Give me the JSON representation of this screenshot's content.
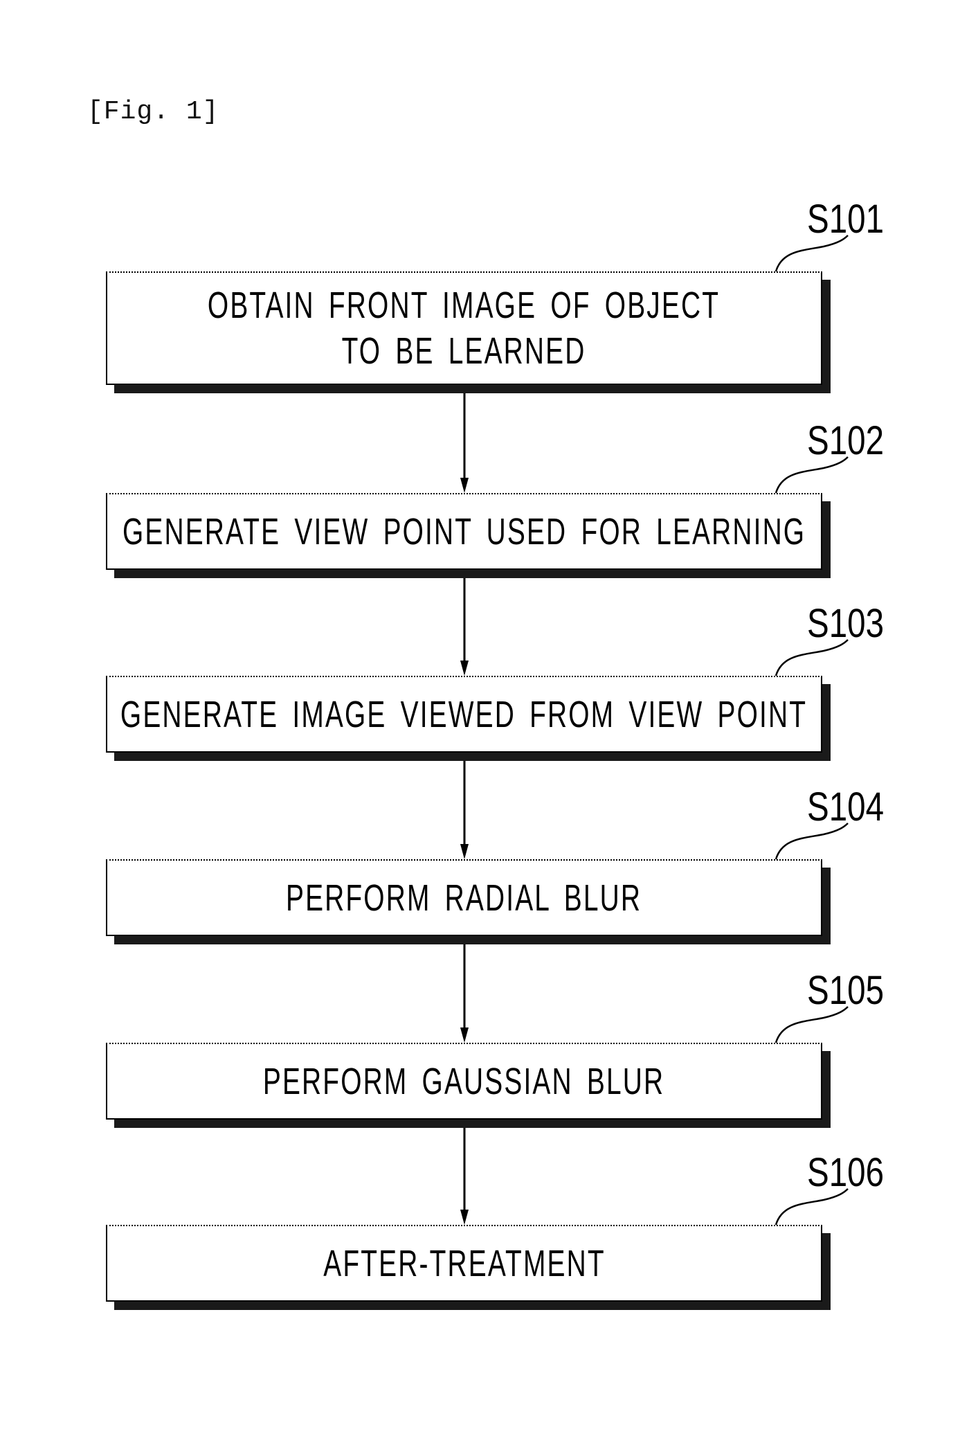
{
  "figure": {
    "label": "[Fig. 1]"
  },
  "steps": [
    {
      "id": "S101",
      "lines": [
        "OBTAIN FRONT IMAGE OF OBJECT",
        "TO BE LEARNED"
      ]
    },
    {
      "id": "S102",
      "lines": [
        "GENERATE VIEW POINT USED FOR LEARNING"
      ]
    },
    {
      "id": "S103",
      "lines": [
        "GENERATE IMAGE VIEWED FROM VIEW POINT"
      ]
    },
    {
      "id": "S104",
      "lines": [
        "PERFORM RADIAL BLUR"
      ]
    },
    {
      "id": "S105",
      "lines": [
        "PERFORM GAUSSIAN BLUR"
      ]
    },
    {
      "id": "S106",
      "lines": [
        "AFTER-TREATMENT"
      ]
    }
  ]
}
